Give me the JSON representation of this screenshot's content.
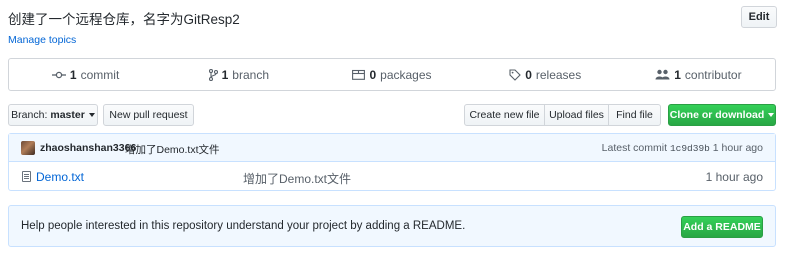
{
  "repo": {
    "description": "创建了一个远程仓库，名字为GitResp2",
    "edit_label": "Edit",
    "manage_topics_label": "Manage topics"
  },
  "summary": {
    "commits": {
      "count": "1",
      "label": "commit",
      "icon": "commit-icon"
    },
    "branches": {
      "count": "1",
      "label": "branch",
      "icon": "branch-icon"
    },
    "packages": {
      "count": "0",
      "label": "packages",
      "icon": "package-icon"
    },
    "releases": {
      "count": "0",
      "label": "releases",
      "icon": "tag-icon"
    },
    "contributors": {
      "count": "1",
      "label": "contributor",
      "icon": "people-icon"
    }
  },
  "toolbar": {
    "branch_prefix": "Branch:",
    "branch_name": "master",
    "new_pull_request_label": "New pull request",
    "create_new_file_label": "Create new file",
    "upload_files_label": "Upload files",
    "find_file_label": "Find file",
    "clone_label": "Clone or download"
  },
  "latest_commit": {
    "author": "zhaoshanshan3366",
    "message": "增加了Demo.txt文件",
    "prefix": "Latest commit",
    "sha": "1c9d39b",
    "age": "1 hour ago"
  },
  "files": [
    {
      "name": "Demo.txt",
      "message": "增加了Demo.txt文件",
      "age": "1 hour ago",
      "icon": "file-icon"
    }
  ],
  "readme": {
    "prompt": "Help people interested in this repository understand your project by adding a README.",
    "button_label": "Add a README"
  },
  "colors": {
    "accent_link": "#0366d6",
    "primary_green": "#28a745",
    "info_bg": "#f1f8ff"
  }
}
